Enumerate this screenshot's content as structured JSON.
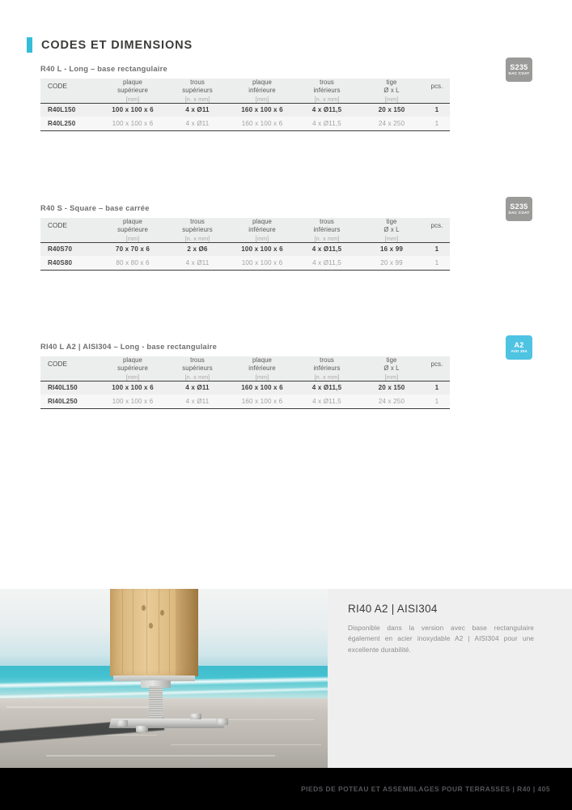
{
  "section": {
    "title": "CODES ET DIMENSIONS",
    "accent_color": "#35bcd8"
  },
  "columns": {
    "code": "CODE",
    "top_plate": "plaque supérieure",
    "top_plate_l1": "plaque",
    "top_plate_l2": "supérieure",
    "top_holes_l1": "trous",
    "top_holes_l2": "supérieurs",
    "bottom_plate_l1": "plaque",
    "bottom_plate_l2": "inférieure",
    "bottom_holes_l1": "trous",
    "bottom_holes_l2": "inférieurs",
    "rod_l1": "tige",
    "rod_l2": "Ø x L",
    "pcs": "pcs.",
    "unit_mm": "[mm]",
    "unit_n_mm": "[n. x mm]"
  },
  "blocks": [
    {
      "title": "R40 L - Long – base rectangulaire",
      "badge": {
        "main": "S235",
        "sub": "DAC COAT",
        "color": "#9a9a99",
        "type": "steel"
      },
      "rows": [
        {
          "code": "R40L150",
          "top_plate": "100 x 100 x 6",
          "top_holes": "4 x Ø11",
          "bottom_plate": "160 x 100 x 6",
          "bottom_holes": "4 x Ø11,5",
          "rod": "20 x 150",
          "pcs": "1",
          "highlight": true
        },
        {
          "code": "R40L250",
          "top_plate": "100 x 100 x 6",
          "top_holes": "4 x Ø11",
          "bottom_plate": "160 x 100 x 6",
          "bottom_holes": "4 x Ø11,5",
          "rod": "24 x 250",
          "pcs": "1",
          "highlight": false
        }
      ]
    },
    {
      "title": "R40 S - Square – base carrée",
      "badge": {
        "main": "S235",
        "sub": "DAC COAT",
        "color": "#9a9a99",
        "type": "steel"
      },
      "rows": [
        {
          "code": "R40S70",
          "top_plate": "70 x 70 x 6",
          "top_holes": "2 x Ø6",
          "bottom_plate": "100 x 100 x 6",
          "bottom_holes": "4 x Ø11,5",
          "rod": "16 x 99",
          "pcs": "1",
          "highlight": true
        },
        {
          "code": "R40S80",
          "top_plate": "80 x 80 x 6",
          "top_holes": "4 x Ø11",
          "bottom_plate": "100 x 100 x 6",
          "bottom_holes": "4 x Ø11,5",
          "rod": "20 x 99",
          "pcs": "1",
          "highlight": false
        }
      ]
    },
    {
      "title": "RI40 L A2 | AISI304 – Long - base rectangulaire",
      "badge": {
        "main": "A2",
        "sub": "AISI 304",
        "color": "#4fc3e2",
        "type": "inox"
      },
      "rows": [
        {
          "code": "RI40L150",
          "top_plate": "100 x 100 x 6",
          "top_holes": "4 x Ø11",
          "bottom_plate": "160 x 100 x 6",
          "bottom_holes": "4 x Ø11,5",
          "rod": "20 x 150",
          "pcs": "1",
          "highlight": true
        },
        {
          "code": "RI40L250",
          "top_plate": "100 x 100 x 6",
          "top_holes": "4 x Ø11",
          "bottom_plate": "160 x 100 x 6",
          "bottom_holes": "4 x Ø11,5",
          "rod": "24 x 250",
          "pcs": "1",
          "highlight": false
        }
      ]
    }
  ],
  "feature": {
    "title": "RI40 A2 | AISI304",
    "body": "Disponible dans la version avec base rectangulaire également en acier inoxydable A2 | AISI304 pour une excellente durabilité.",
    "photo_alt": "post-base-on-terrace"
  },
  "footer": {
    "text": "PIEDS DE POTEAU ET ASSEMBLAGES POUR TERRASSES  |  R40  |  405"
  }
}
